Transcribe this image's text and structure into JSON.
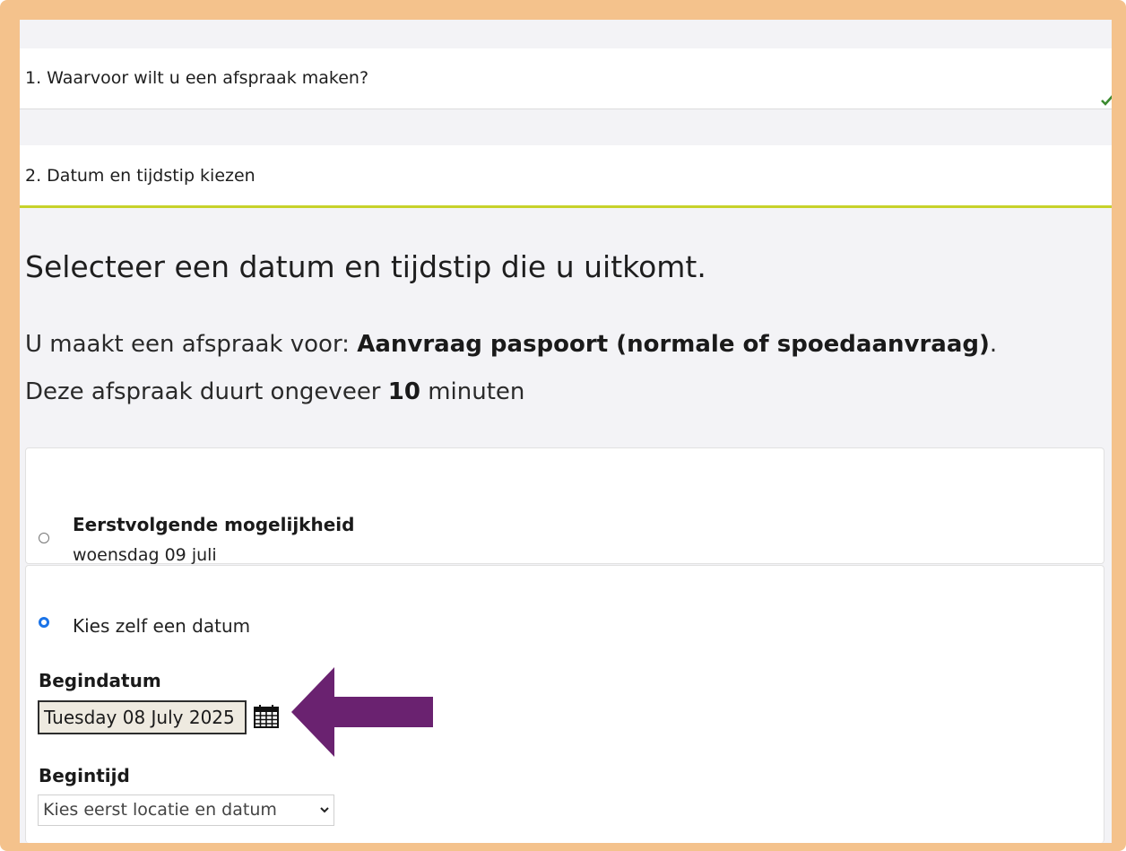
{
  "steps": [
    {
      "label": "1. Waarvoor wilt u een afspraak maken?",
      "completed": true
    },
    {
      "label": "2. Datum en tijdstip kiezen",
      "active": true
    }
  ],
  "main": {
    "heading": "Selecteer een datum en tijdstip die u uitkomt.",
    "appointment_prefix": "U maakt een afspraak voor: ",
    "appointment_type": "Aanvraag paspoort (normale of spoedaanvraag)",
    "appointment_suffix": ".",
    "duration_prefix": "Deze afspraak duurt ongeveer ",
    "duration_value": "10",
    "duration_suffix": " minuten"
  },
  "options": {
    "next_available": {
      "title": "Eerstvolgende mogelijkheid",
      "date": "woensdag 09 juli",
      "selected": false
    },
    "choose_date": {
      "label": "Kies zelf een datum",
      "selected": true
    }
  },
  "fields": {
    "begindatum_label": "Begindatum",
    "begindatum_value": "Tuesday 08 July 2025",
    "begintijd_label": "Begintijd",
    "begintijd_value": "Kies eerst locatie en datum"
  },
  "icons": {
    "check": "check-icon",
    "calendar": "calendar-icon",
    "arrow": "arrow-left-icon",
    "chevron": "chevron-down-icon"
  },
  "colors": {
    "frame": "#f4c28c",
    "active_underline": "#c7d22a",
    "check": "#3b8a2f",
    "radio_selected": "#1a73e8",
    "arrow": "#6a2270"
  }
}
